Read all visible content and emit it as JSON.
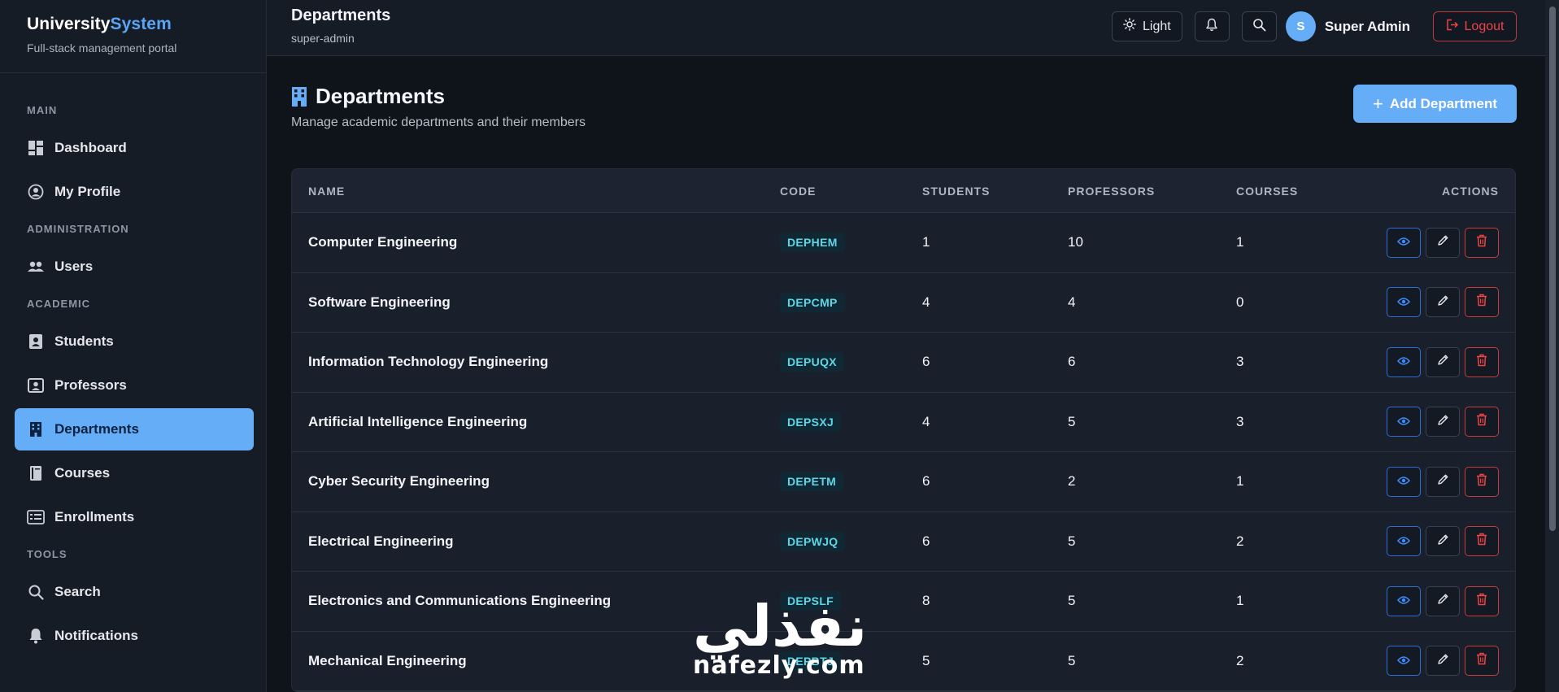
{
  "brand": {
    "title_part1": "University",
    "title_part2": "System",
    "subtitle": "Full-stack management portal"
  },
  "sidebar": {
    "sections": [
      {
        "label": "MAIN",
        "items": [
          {
            "label": "Dashboard",
            "icon": "dashboard-icon"
          },
          {
            "label": "My Profile",
            "icon": "user-circle-icon"
          }
        ]
      },
      {
        "label": "ADMINISTRATION",
        "items": [
          {
            "label": "Users",
            "icon": "users-icon"
          }
        ]
      },
      {
        "label": "ACADEMIC",
        "items": [
          {
            "label": "Students",
            "icon": "id-card-icon"
          },
          {
            "label": "Professors",
            "icon": "id-badge-icon"
          },
          {
            "label": "Departments",
            "icon": "building-icon",
            "active": true
          },
          {
            "label": "Courses",
            "icon": "book-icon"
          },
          {
            "label": "Enrollments",
            "icon": "list-card-icon"
          }
        ]
      },
      {
        "label": "TOOLS",
        "items": [
          {
            "label": "Search",
            "icon": "search-icon"
          },
          {
            "label": "Notifications",
            "icon": "bell-icon"
          }
        ]
      }
    ]
  },
  "topbar": {
    "title": "Departments",
    "subtitle": "super-admin",
    "theme_label": "Light",
    "user_initial": "S",
    "user_name": "Super Admin",
    "logout_label": "Logout"
  },
  "page": {
    "title": "Departments",
    "subtitle": "Manage academic departments and their members",
    "add_button": "Add Department"
  },
  "table": {
    "headers": [
      "NAME",
      "CODE",
      "STUDENTS",
      "PROFESSORS",
      "COURSES",
      "ACTIONS"
    ],
    "rows": [
      {
        "name": "Computer Engineering",
        "code": "DEPHEM",
        "students": "1",
        "professors": "10",
        "courses": "1"
      },
      {
        "name": "Software Engineering",
        "code": "DEPCMP",
        "students": "4",
        "professors": "4",
        "courses": "0"
      },
      {
        "name": "Information Technology Engineering",
        "code": "DEPUQX",
        "students": "6",
        "professors": "6",
        "courses": "3"
      },
      {
        "name": "Artificial Intelligence Engineering",
        "code": "DEPSXJ",
        "students": "4",
        "professors": "5",
        "courses": "3"
      },
      {
        "name": "Cyber Security Engineering",
        "code": "DEPETM",
        "students": "6",
        "professors": "2",
        "courses": "1"
      },
      {
        "name": "Electrical Engineering",
        "code": "DEPWJQ",
        "students": "6",
        "professors": "5",
        "courses": "2"
      },
      {
        "name": "Electronics and Communications Engineering",
        "code": "DEPSLF",
        "students": "8",
        "professors": "5",
        "courses": "1"
      },
      {
        "name": "Mechanical Engineering",
        "code": "DEPBTJ",
        "students": "5",
        "professors": "5",
        "courses": "2"
      }
    ]
  },
  "watermark": {
    "arabic": "نفذلي",
    "latin": "nafezly.com"
  },
  "colors": {
    "accent": "#66adf7",
    "danger": "#ef4444",
    "badge_text": "#5fd6e6",
    "background": "#0f141b",
    "sidebar": "#161c26"
  }
}
